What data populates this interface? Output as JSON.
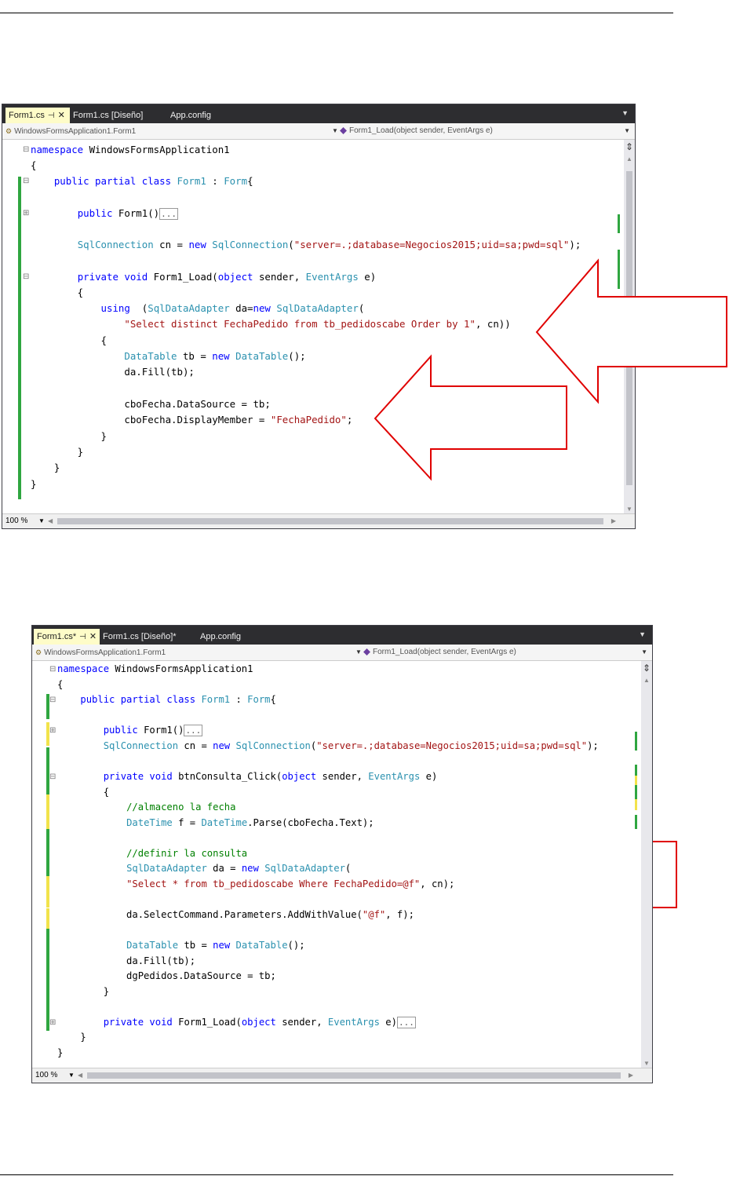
{
  "screenshots": [
    {
      "tabs": [
        {
          "label": "Form1.cs",
          "active": true
        },
        {
          "label": "Form1.cs [Diseño]",
          "active": false
        },
        {
          "label": "App.config",
          "active": false
        }
      ],
      "nav_left": "WindowsFormsApplication1.Form1",
      "nav_right": "Form1_Load(object sender, EventArgs e)",
      "zoom": "100 %",
      "lines": [
        "namespace WindowsFormsApplication1",
        "{",
        "    public partial class Form1 : Form{",
        "",
        "        public Form1()...",
        "",
        "        SqlConnection cn = new SqlConnection(\"server=.;database=Negocios2015;uid=sa;pwd=sql\");",
        "",
        "        private void Form1_Load(object sender, EventArgs e)",
        "        {",
        "            using  (SqlDataAdapter da=new SqlDataAdapter(",
        "                \"Select distinct FechaPedido from tb_pedidoscabe Order by 1\", cn))",
        "            {",
        "                DataTable tb = new DataTable();",
        "                da.Fill(tb);",
        "",
        "                cboFecha.DataSource = tb;",
        "                cboFecha.DisplayMember = \"FechaPedido\";",
        "            }",
        "        }",
        "    }",
        "}"
      ]
    },
    {
      "tabs": [
        {
          "label": "Form1.cs*",
          "active": true
        },
        {
          "label": "Form1.cs [Diseño]*",
          "active": false
        },
        {
          "label": "App.config",
          "active": false
        }
      ],
      "nav_left": "WindowsFormsApplication1.Form1",
      "nav_right": "Form1_Load(object sender, EventArgs e)",
      "zoom": "100 %",
      "lines": [
        "namespace WindowsFormsApplication1",
        "{",
        "    public partial class Form1 : Form{",
        "",
        "        public Form1()...",
        "        SqlConnection cn = new SqlConnection(\"server=.;database=Negocios2015;uid=sa;pwd=sql\");",
        "",
        "        private void btnConsulta_Click(object sender, EventArgs e)",
        "        {",
        "            //almaceno la fecha",
        "            DateTime f = DateTime.Parse(cboFecha.Text);",
        "",
        "            //definir la consulta",
        "            SqlDataAdapter da = new SqlDataAdapter(",
        "            \"Select * from tb_pedidoscabe Where FechaPedido=@f\", cn);",
        "",
        "            da.SelectCommand.Parameters.AddWithValue(\"@f\", f);",
        "",
        "            DataTable tb = new DataTable();",
        "            da.Fill(tb);",
        "            dgPedidos.DataSource = tb;",
        "        }",
        "",
        "        private void Form1_Load(object sender, EventArgs e)...",
        "    }",
        "}"
      ]
    }
  ]
}
